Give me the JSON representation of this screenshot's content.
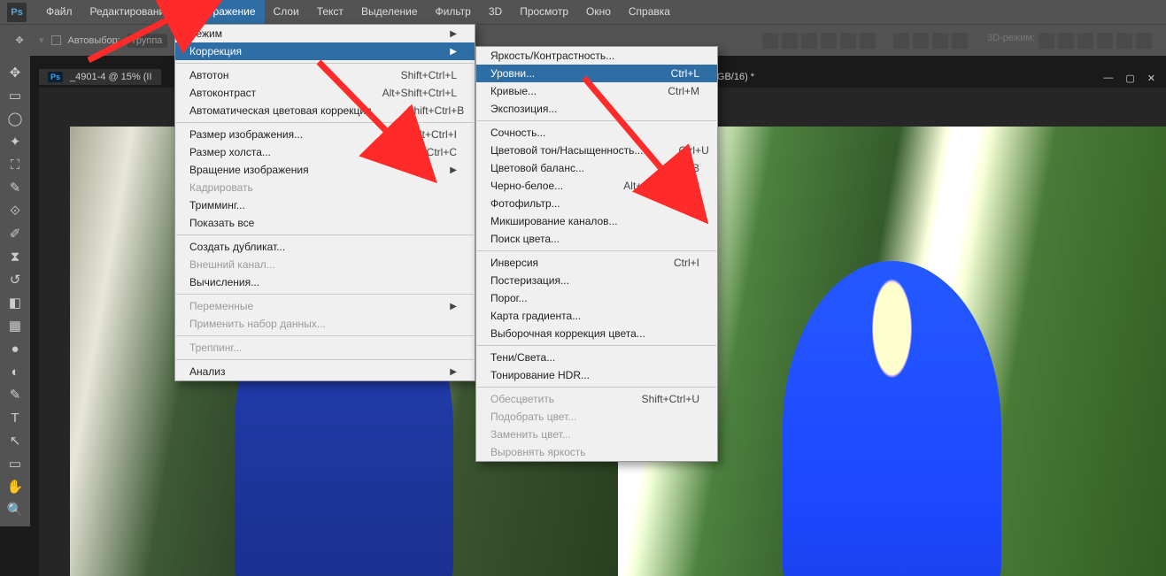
{
  "menubar": {
    "items": [
      "Файл",
      "Редактирование",
      "Изображение",
      "Слои",
      "Текст",
      "Выделение",
      "Фильтр",
      "3D",
      "Просмотр",
      "Окно",
      "Справка"
    ],
    "open_index": 2
  },
  "optionsbar": {
    "auto_select": "Автовыбор:",
    "group": "группа",
    "mode3d": "3D-режим:"
  },
  "tabs": {
    "tab1_label": "_4901-4 @ 15% (II",
    "overflow": "@ 15% (IMG_4901, RGB/16) *"
  },
  "menu1": [
    {
      "label": "Режим",
      "arrow": true
    },
    {
      "label": "Коррекция",
      "arrow": true,
      "hl": true
    },
    {
      "sep": true
    },
    {
      "label": "Автотон",
      "short": "Shift+Ctrl+L"
    },
    {
      "label": "Автоконтраст",
      "short": "Alt+Shift+Ctrl+L"
    },
    {
      "label": "Автоматическая цветовая коррекция",
      "short": "Shift+Ctrl+B"
    },
    {
      "sep": true
    },
    {
      "label": "Размер изображения...",
      "short": "Alt+Ctrl+I"
    },
    {
      "label": "Размер холста...",
      "short": "Alt+Ctrl+C"
    },
    {
      "label": "Вращение изображения",
      "arrow": true
    },
    {
      "label": "Кадрировать",
      "disabled": true
    },
    {
      "label": "Тримминг..."
    },
    {
      "label": "Показать все"
    },
    {
      "sep": true
    },
    {
      "label": "Создать дубликат..."
    },
    {
      "label": "Внешний канал...",
      "disabled": true
    },
    {
      "label": "Вычисления..."
    },
    {
      "sep": true
    },
    {
      "label": "Переменные",
      "arrow": true,
      "disabled": true
    },
    {
      "label": "Применить набор данных...",
      "disabled": true
    },
    {
      "sep": true
    },
    {
      "label": "Треппинг...",
      "disabled": true
    },
    {
      "sep": true
    },
    {
      "label": "Анализ",
      "arrow": true
    }
  ],
  "menu2": [
    {
      "label": "Яркость/Контрастность..."
    },
    {
      "label": "Уровни...",
      "short": "Ctrl+L",
      "hl": true
    },
    {
      "label": "Кривые...",
      "short": "Ctrl+M"
    },
    {
      "label": "Экспозиция..."
    },
    {
      "sep": true
    },
    {
      "label": "Сочность..."
    },
    {
      "label": "Цветовой тон/Насыщенность...",
      "short": "Ctrl+U"
    },
    {
      "label": "Цветовой баланс...",
      "short": "Ctrl+B"
    },
    {
      "label": "Черно-белое...",
      "short": "Alt+Shift+Ctrl+B"
    },
    {
      "label": "Фотофильтр..."
    },
    {
      "label": "Микширование каналов..."
    },
    {
      "label": "Поиск цвета..."
    },
    {
      "sep": true
    },
    {
      "label": "Инверсия",
      "short": "Ctrl+I"
    },
    {
      "label": "Постеризация..."
    },
    {
      "label": "Порог..."
    },
    {
      "label": "Карта градиента..."
    },
    {
      "label": "Выборочная коррекция цвета..."
    },
    {
      "sep": true
    },
    {
      "label": "Тени/Света..."
    },
    {
      "label": "Тонирование HDR..."
    },
    {
      "sep": true
    },
    {
      "label": "Обесцветить",
      "short": "Shift+Ctrl+U",
      "disabled": true
    },
    {
      "label": "Подобрать цвет...",
      "disabled": true
    },
    {
      "label": "Заменить цвет...",
      "disabled": true
    },
    {
      "label": "Выровнять яркость",
      "disabled": true
    }
  ]
}
